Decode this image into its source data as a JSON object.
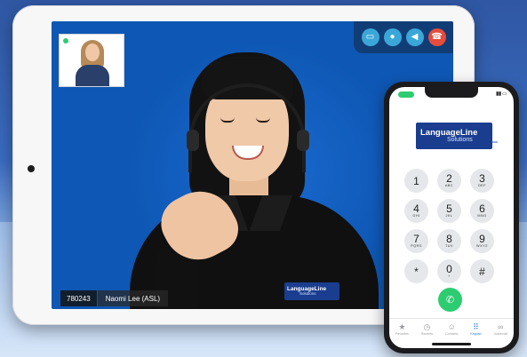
{
  "video_call": {
    "caption": {
      "id": "780243",
      "name": "Naomi Lee (ASL)"
    },
    "controls": [
      {
        "name": "video-camera-icon",
        "glyph": "▭"
      },
      {
        "name": "microphone-icon",
        "glyph": "●"
      },
      {
        "name": "speaker-icon",
        "glyph": "◀"
      },
      {
        "name": "end-call-icon",
        "glyph": "☎"
      }
    ],
    "shirt_logo": {
      "line1": "LanguageLine",
      "line2": "Solutions"
    }
  },
  "phone": {
    "logo": {
      "line1": "LanguageLine",
      "line2": "Solutions"
    },
    "keypad": [
      {
        "digit": "1",
        "letters": ""
      },
      {
        "digit": "2",
        "letters": "ABC"
      },
      {
        "digit": "3",
        "letters": "DEF"
      },
      {
        "digit": "4",
        "letters": "GHI"
      },
      {
        "digit": "5",
        "letters": "JKL"
      },
      {
        "digit": "6",
        "letters": "MNO"
      },
      {
        "digit": "7",
        "letters": "PQRS"
      },
      {
        "digit": "8",
        "letters": "TUV"
      },
      {
        "digit": "9",
        "letters": "WXYZ"
      },
      {
        "digit": "*",
        "letters": ""
      },
      {
        "digit": "0",
        "letters": "+"
      },
      {
        "digit": "#",
        "letters": ""
      }
    ],
    "call_glyph": "✆",
    "tabs": [
      {
        "name": "tab-favorites",
        "icon": "star-icon",
        "glyph": "★",
        "label": "Favorites"
      },
      {
        "name": "tab-recents",
        "icon": "clock-icon",
        "glyph": "◷",
        "label": "Recents"
      },
      {
        "name": "tab-contacts",
        "icon": "contacts-icon",
        "glyph": "☺",
        "label": "Contacts"
      },
      {
        "name": "tab-keypad",
        "icon": "keypad-icon",
        "glyph": "⠿",
        "label": "Keypad"
      },
      {
        "name": "tab-voicemail",
        "icon": "voicemail-icon",
        "glyph": "∞",
        "label": "Voicemail"
      }
    ]
  },
  "colors": {
    "screen_blue": "#0e57b4",
    "accent_green": "#2ecc71",
    "end_call_red": "#e74c3c",
    "brand_navy": "#1a3d8f"
  }
}
